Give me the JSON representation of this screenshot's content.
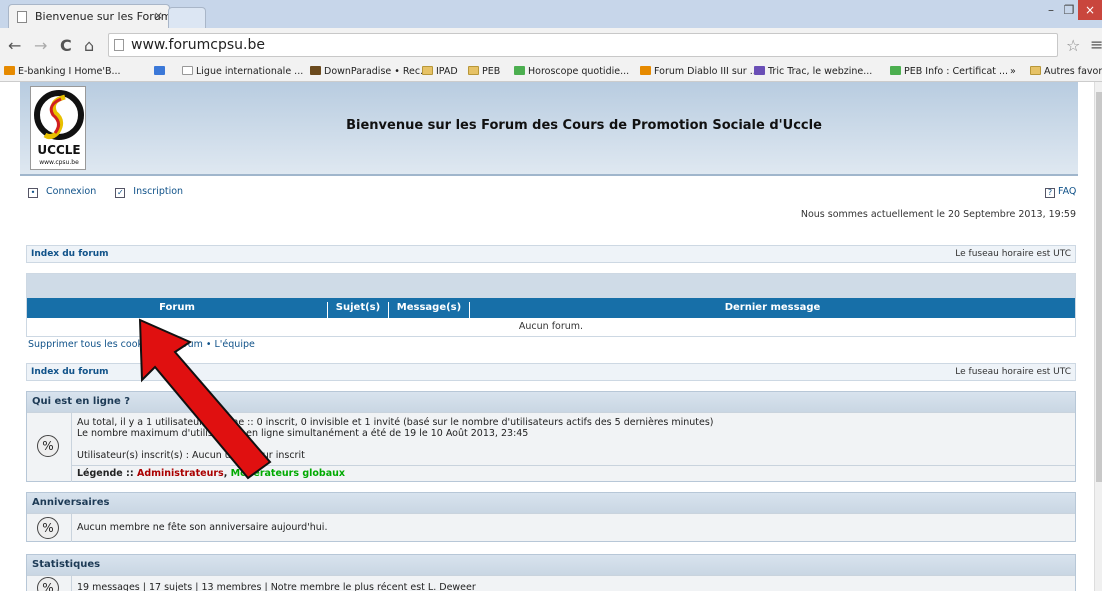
{
  "browser": {
    "tab_title": "Bienvenue sur les Forum c",
    "tab_close": "×",
    "url": "www.forumcpsu.be",
    "win_min": "–",
    "win_max": "❐",
    "win_close": "×",
    "back": "←",
    "forward": "→",
    "reload": "C",
    "home": "⌂",
    "star": "☆",
    "menu": "≡",
    "bookmarks": [
      {
        "label": "E-banking I Home'B...",
        "icon": "orange"
      },
      {
        "label": "",
        "icon": "blue"
      },
      {
        "label": "Ligue internationale ...",
        "icon": "page"
      },
      {
        "label": "DownParadise • Rec...",
        "icon": "brown"
      },
      {
        "label": "IPAD",
        "icon": "folder"
      },
      {
        "label": "PEB",
        "icon": "folder"
      },
      {
        "label": "Horoscope quotidie...",
        "icon": "green"
      },
      {
        "label": "Forum Diablo III sur ...",
        "icon": "orange"
      },
      {
        "label": "Tric Trac, le webzine...",
        "icon": "purple"
      },
      {
        "label": "PEB Info : Certificat ...",
        "icon": "green"
      }
    ],
    "bookmarks_more": "»",
    "other_bookmarks": "Autres favoris"
  },
  "header": {
    "title": "Bienvenue sur les Forum des Cours de Promotion Sociale d'Uccle",
    "logo_text": "UCCLE",
    "logo_sub": "www.cpsu.be"
  },
  "topnav": {
    "login": "Connexion",
    "register": "Inscription",
    "faq": "FAQ"
  },
  "date_line": "Nous sommes actuellement le 20 Septembre 2013, 19:59",
  "index_bar": {
    "index": "Index du forum",
    "timezone": "Le fuseau horaire est UTC"
  },
  "forum_table": {
    "col_forum": "Forum",
    "col_topics": "Sujet(s)",
    "col_posts": "Message(s)",
    "col_last": "Dernier message",
    "empty": "Aucun forum."
  },
  "cookie_links": "Supprimer tous les cookies du forum • L'équipe",
  "online": {
    "title": "Qui est en ligne ?",
    "line1": "Au total, il y a 1 utilisateur en ligne :: 0 inscrit, 0 invisible et 1 invité (basé sur le nombre d'utilisateurs actifs des 5 dernières minutes)",
    "line2": "Le nombre maximum d'utilisateurs en ligne simultanément a été de 19 le 10 Août 2013, 23:45",
    "line3": "Utilisateur(s) inscrit(s) : Aucun utilisateur inscrit",
    "legend_label": "Légende ::",
    "legend_admin": "Administrateurs",
    "legend_sep": ",",
    "legend_mod": "Modérateurs globaux"
  },
  "birthdays": {
    "title": "Anniversaires",
    "text": "Aucun membre ne fête son anniversaire aujourd'hui."
  },
  "stats": {
    "title": "Statistiques",
    "text": "19 messages | 17 sujets | 13 membres | Notre membre le plus récent est L. Deweer"
  },
  "colors": {
    "forum_head": "#176fa8",
    "admin": "#aa0000",
    "moderator": "#00aa00",
    "arrow": "#e01010"
  }
}
